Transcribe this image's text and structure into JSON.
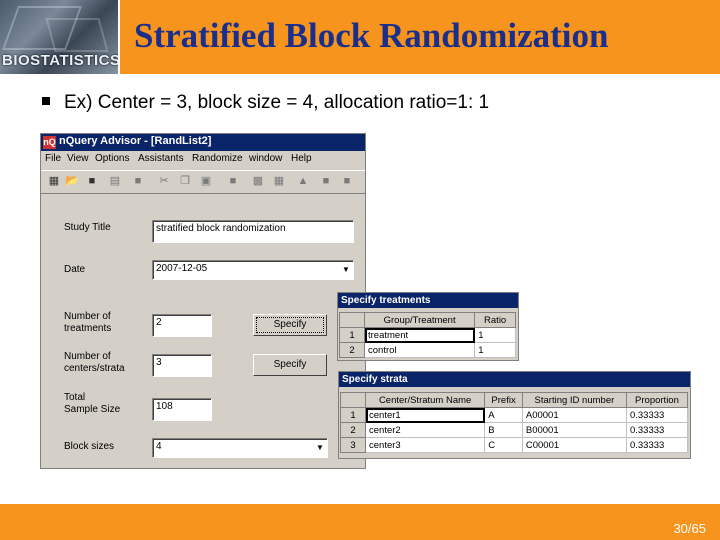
{
  "slide": {
    "logo_text": "BIOSTATISTICS",
    "title": "Stratified Block Randomization",
    "bullet": "Ex) Center = 3, block size = 4, allocation ratio=1: 1",
    "page_number": "30/65",
    "colors": {
      "accent": "#f7941d",
      "title_text": "#1a2e8c"
    }
  },
  "app": {
    "title": "nQuery Advisor - [RandList2]",
    "menu": [
      "File",
      "View",
      "Options",
      "Assistants",
      "Randomize",
      "window",
      "Help"
    ],
    "toolbar_icons": [
      "grid-icon",
      "open-folder-icon",
      "save-icon",
      "print-icon",
      "block-icon",
      "cut-icon",
      "copy-icon",
      "paste-icon",
      "save2-icon",
      "chart-icon",
      "export-icon",
      "triangle-icon",
      "text-icon",
      "window-icon"
    ],
    "form": {
      "study_title": {
        "label": "Study Title",
        "value": "stratified block randomization"
      },
      "date": {
        "label": "Date",
        "value": "2007-12-05"
      },
      "num_treatments": {
        "label_line1": "Number of",
        "label_line2": "treatments",
        "value": "2",
        "button": "Specify"
      },
      "num_centers": {
        "label_line1": "Number of",
        "label_line2": "centers/strata",
        "value": "3",
        "button": "Specify"
      },
      "total_sample": {
        "label_line1": "Total",
        "label_line2": "Sample Size",
        "value": "108"
      },
      "block_sizes": {
        "label": "Block sizes",
        "value": "4"
      }
    }
  },
  "treatments_dialog": {
    "title": "Specify treatments",
    "headers": [
      "Group/Treatment",
      "Ratio"
    ],
    "rows": [
      {
        "num": "1",
        "name": "treatment",
        "ratio": "1"
      },
      {
        "num": "2",
        "name": "control",
        "ratio": "1"
      }
    ]
  },
  "strata_dialog": {
    "title": "Specify strata",
    "headers": [
      "Center/Stratum Name",
      "Prefix",
      "Starting ID number",
      "Proportion"
    ],
    "rows": [
      {
        "num": "1",
        "name": "center1",
        "prefix": "A",
        "start_id": "A00001",
        "proportion": "0.33333"
      },
      {
        "num": "2",
        "name": "center2",
        "prefix": "B",
        "start_id": "B00001",
        "proportion": "0.33333"
      },
      {
        "num": "3",
        "name": "center3",
        "prefix": "C",
        "start_id": "C00001",
        "proportion": "0.33333"
      }
    ]
  }
}
